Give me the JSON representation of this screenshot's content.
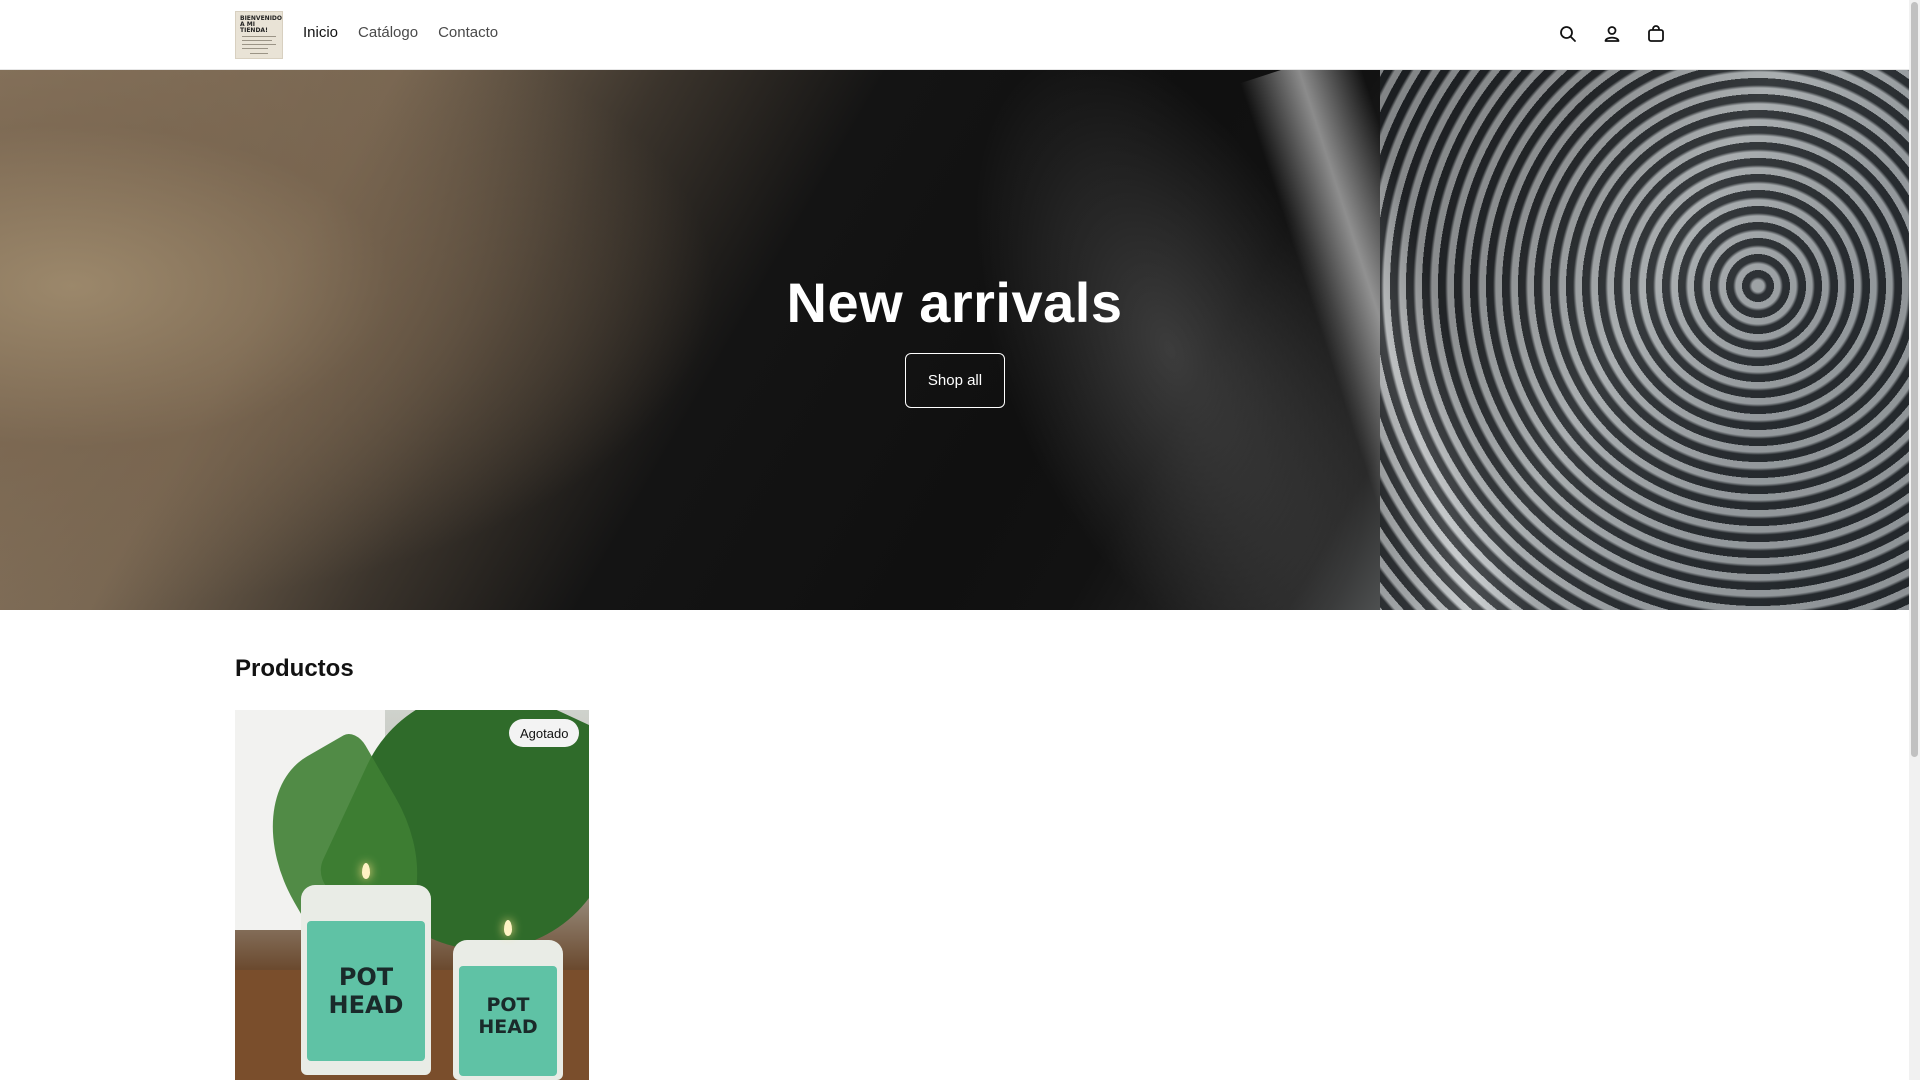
{
  "header": {
    "logo_text": "BIENVENIDO A MI TIENDA!",
    "nav": [
      {
        "label": "Inicio",
        "active": true
      },
      {
        "label": "Catálogo",
        "active": false
      },
      {
        "label": "Contacto",
        "active": false
      }
    ],
    "icons": [
      "search-icon",
      "account-icon",
      "cart-icon"
    ]
  },
  "hero": {
    "title": "New arrivals",
    "button_label": "Shop all"
  },
  "products": {
    "section_title": "Productos",
    "items": [
      {
        "badge": "Agotado",
        "jar_label": "POT HEAD"
      }
    ]
  },
  "colors": {
    "text": "#121212",
    "badge_bg": "#f3f3f3",
    "jar_label": "#5fc2a5"
  }
}
